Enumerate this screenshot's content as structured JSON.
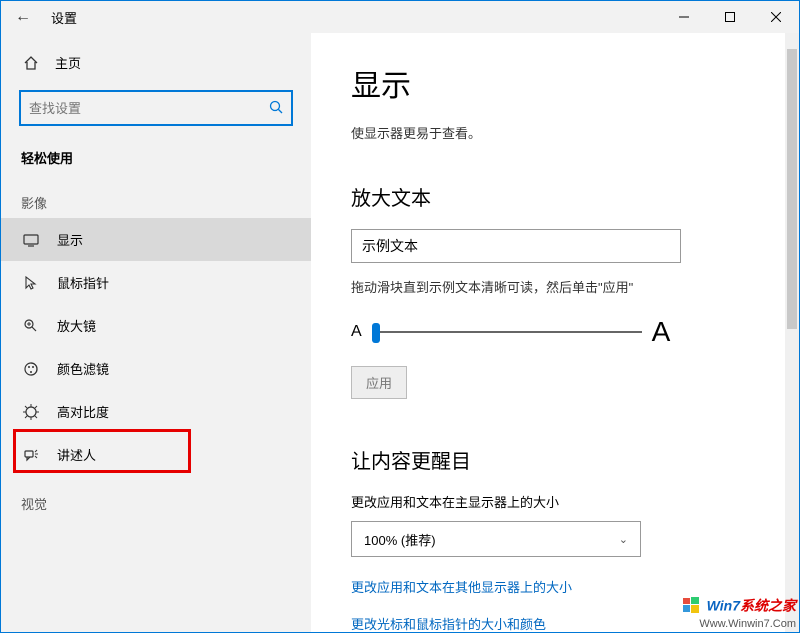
{
  "titlebar": {
    "title": "设置"
  },
  "sidebar": {
    "home": "主页",
    "search_placeholder": "查找设置",
    "section": "轻松使用",
    "cat_yingxiang": "影像",
    "items": [
      {
        "label": "显示"
      },
      {
        "label": "鼠标指针"
      },
      {
        "label": "放大镜"
      },
      {
        "label": "颜色滤镜"
      },
      {
        "label": "高对比度"
      },
      {
        "label": "讲述人"
      }
    ],
    "cat_shijue": "视觉"
  },
  "content": {
    "heading": "显示",
    "sub": "使显示器更易于查看。",
    "enlarge_heading": "放大文本",
    "sample_text": "示例文本",
    "slider_hint": "拖动滑块直到示例文本清晰可读，然后单击\"应用\"",
    "apply": "应用",
    "bold_heading": "让内容更醒目",
    "scale_label": "更改应用和文本在主显示器上的大小",
    "scale_value": "100% (推荐)",
    "link1": "更改应用和文本在其他显示器上的大小",
    "link2": "更改光标和鼠标指针的大小和颜色"
  },
  "watermark": {
    "line1a": "Win7",
    "line1b": "系统之家",
    "line2": "Www.Winwin7.Com"
  }
}
